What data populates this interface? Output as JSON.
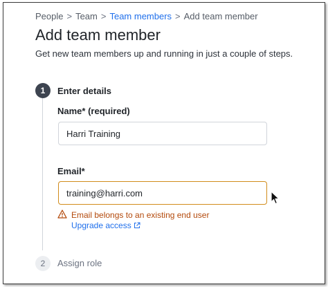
{
  "breadcrumb": {
    "items": [
      {
        "label": "People"
      },
      {
        "label": "Team"
      },
      {
        "label": "Team members"
      },
      {
        "label": "Add team member"
      }
    ],
    "separator": ">"
  },
  "header": {
    "title": "Add team member",
    "subtitle": "Get new team members up and running in just a couple of steps."
  },
  "steps": [
    {
      "number": "1",
      "title": "Enter details",
      "state": "active"
    },
    {
      "number": "2",
      "title": "Assign role",
      "state": "inactive"
    }
  ],
  "form": {
    "name": {
      "label": "Name* (required)",
      "value": "Harri Training"
    },
    "email": {
      "label": "Email*",
      "value": "training@harri.com",
      "warning": "Email belongs to an existing end user",
      "link_label": "Upgrade access"
    }
  },
  "colors": {
    "link": "#1f6feb",
    "warning_text": "#b3490b",
    "warning_border": "#d18b1a",
    "active_step": "#3d4450"
  },
  "icons": {
    "warning": "warning-triangle-icon",
    "external": "external-link-icon",
    "separator": "chevron-right-icon"
  }
}
